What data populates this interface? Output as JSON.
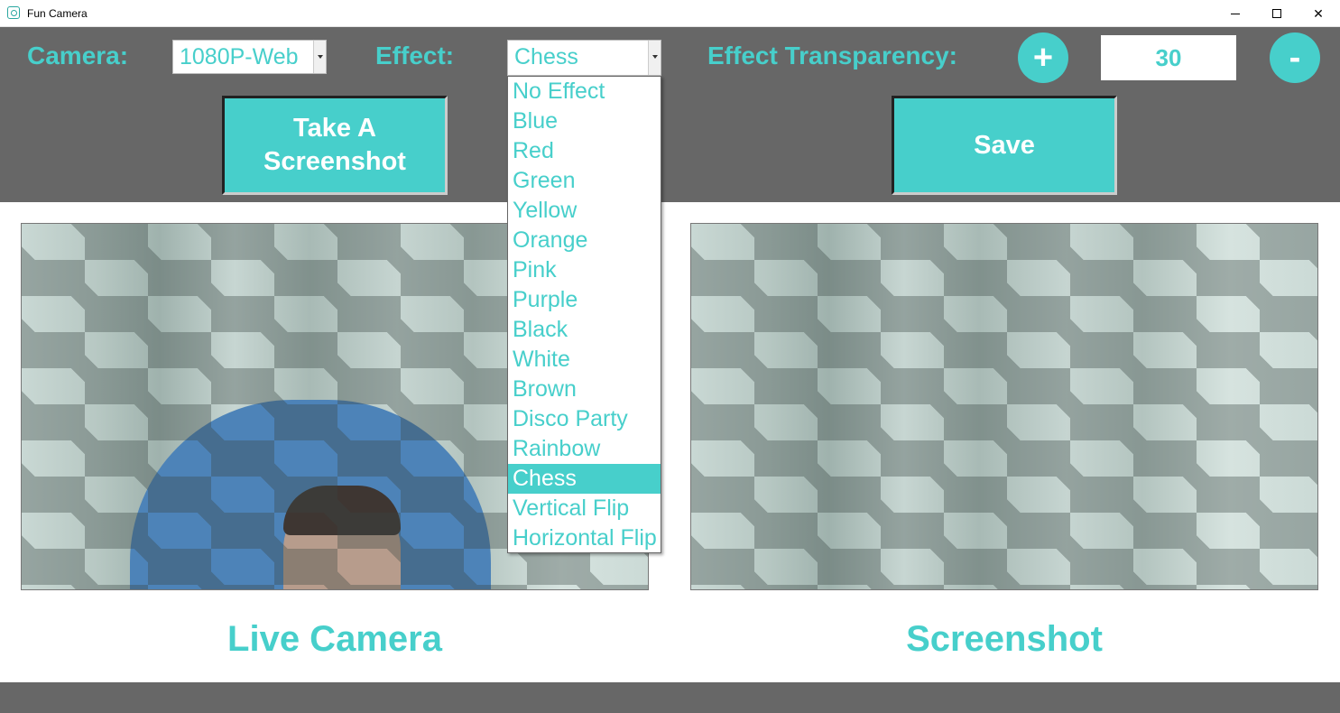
{
  "window": {
    "title": "Fun Camera"
  },
  "controls": {
    "camera_label": "Camera:",
    "camera_value": "1080P-Web",
    "effect_label": "Effect:",
    "effect_value": "Chess",
    "transparency_label": "Effect Transparency:",
    "plus_label": "+",
    "transparency_value": "30",
    "minus_label": "-"
  },
  "buttons": {
    "screenshot_label": "Take A\nScreenshot",
    "save_label": "Save"
  },
  "effect_options": [
    {
      "label": "No Effect"
    },
    {
      "label": "Blue"
    },
    {
      "label": "Red"
    },
    {
      "label": "Green"
    },
    {
      "label": "Yellow"
    },
    {
      "label": "Orange"
    },
    {
      "label": "Pink"
    },
    {
      "label": "Purple"
    },
    {
      "label": "Black"
    },
    {
      "label": "White"
    },
    {
      "label": "Brown"
    },
    {
      "label": "Disco Party"
    },
    {
      "label": "Rainbow"
    },
    {
      "label": "Chess",
      "selected": true
    },
    {
      "label": "Vertical Flip"
    },
    {
      "label": "Horizontal Flip"
    }
  ],
  "panes": {
    "live_caption": "Live Camera",
    "screenshot_caption": "Screenshot"
  },
  "colors": {
    "accent": "#47cfcb",
    "panel": "#676767"
  },
  "icons": {
    "app": "camera-icon",
    "minimize": "minimize-icon",
    "maximize": "maximize-icon",
    "close": "close-icon"
  }
}
